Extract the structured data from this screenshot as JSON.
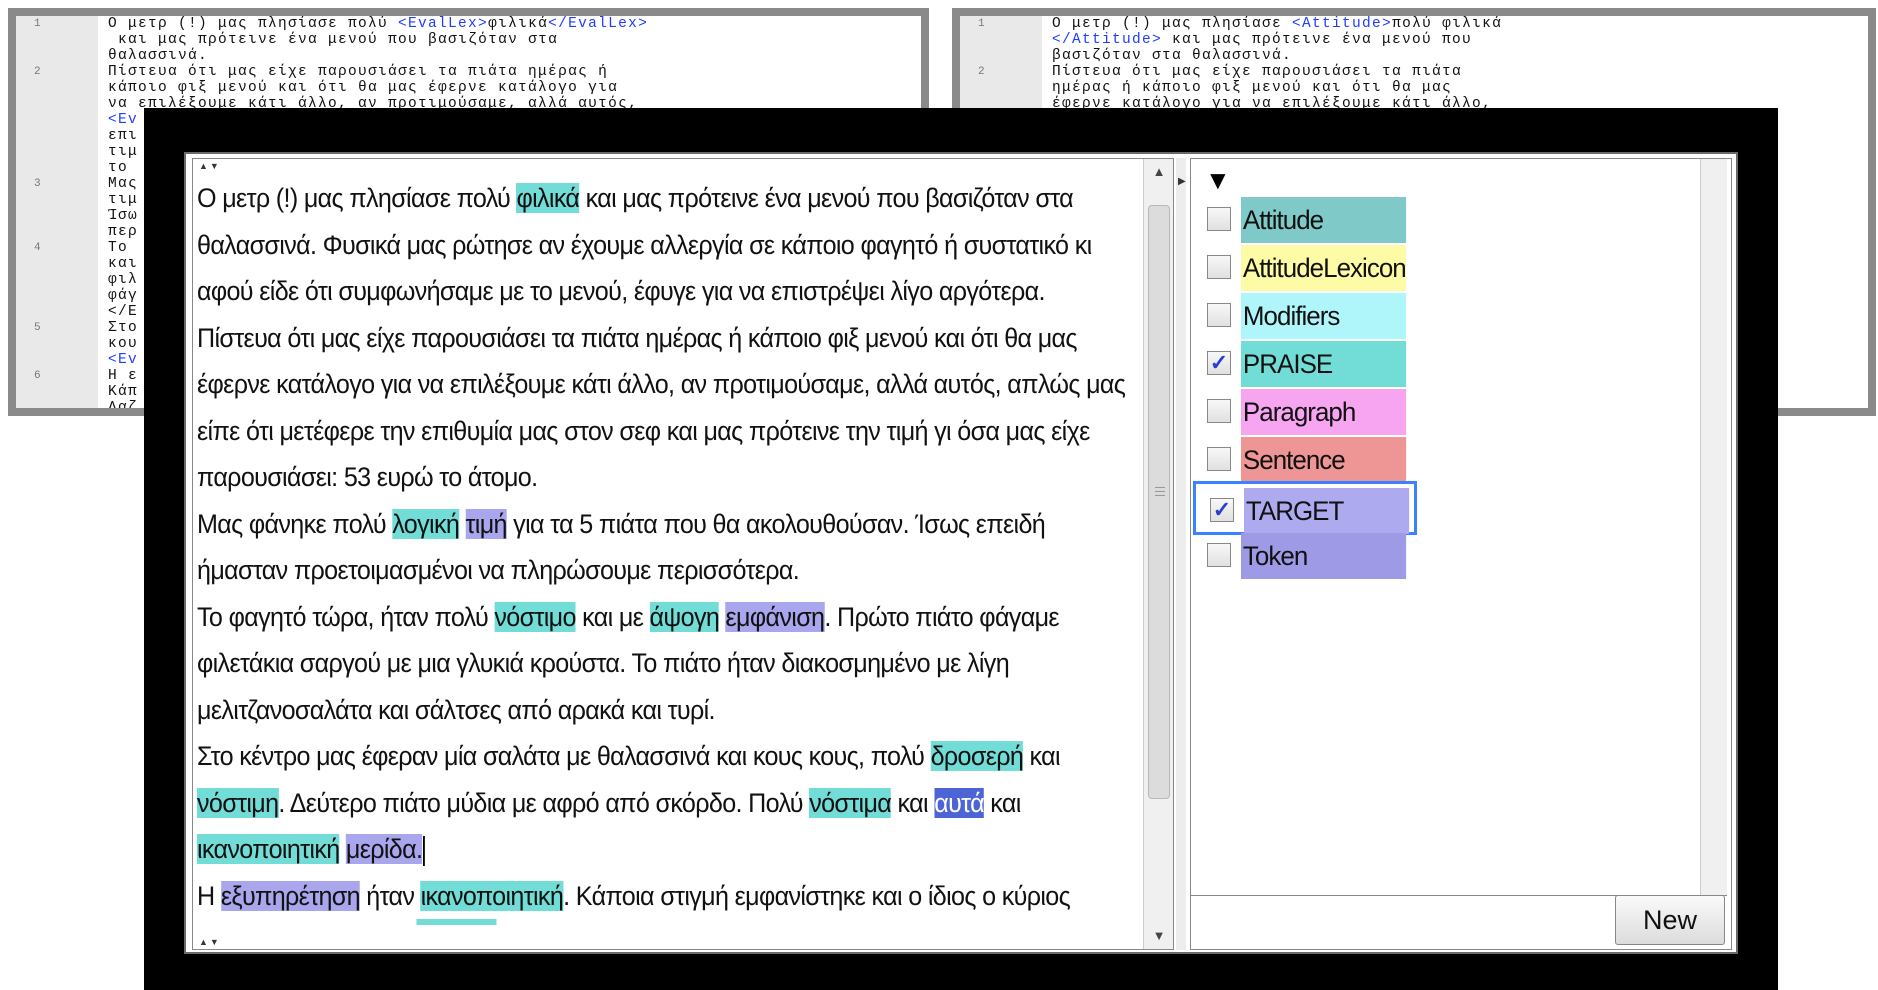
{
  "xml_left": {
    "lines": [
      {
        "num": "1",
        "text": "Ο μετρ (!) μας πλησίασε πολύ <EvalLex>φιλικά</EvalLex>\n και μας πρότεινε ένα μενού που βασιζόταν στα\nθαλασσινά."
      },
      {
        "num": "2",
        "text": "Πίστευα ότι μας είχε παρουσιάσει τα πιάτα ημέρας ή\nκάποιο φιξ μενού και ότι θα μας έφερνε κατάλογο για\nνα επιλέξουμε κάτι άλλο, αν προτιμούσαμε, αλλά αυτός,\n<Ev\nεπι\nτιμ\nτο"
      },
      {
        "num": "3",
        "text": "Μας\nτιμ\nΊσω\nπερ"
      },
      {
        "num": "4",
        "text": "Το\nκαι\nφιλ\nφάγ\n</E"
      },
      {
        "num": "5",
        "text": "Στο\nκου\n<Ev"
      },
      {
        "num": "6",
        "text": "Η ε\nΚάπ\nΛαζ\nπολ"
      }
    ]
  },
  "xml_right": {
    "lines": [
      {
        "num": "1",
        "text": "Ο μετρ (!) μας πλησίασε <Attitude>πολύ φιλικά\n</Attitude> και μας πρότεινε ένα μενού που\nβασιζόταν στα θαλασσινά."
      },
      {
        "num": "2",
        "text": "Πίστευα ότι μας είχε παρουσιάσει τα πιάτα\nημέρας ή κάποιο φιξ μενού και ότι θα μας\nέφερνε κατάλογο για να επιλέξουμε κάτι άλλο,\nότι μετέφερε την επιθυμία μας στον σεφ και μας"
      }
    ]
  },
  "editor": {
    "paragraphs": [
      [
        {
          "t": "Ο μετρ (!) μας πλησίασε πολύ "
        },
        {
          "t": "φιλικά",
          "h": "praise"
        },
        {
          "t": " και μας πρότεινε ένα μενού που βασιζόταν στα θαλασσινά. Φυσικά μας ρώτησε αν έχουμε αλλεργία σε κάποιο φαγητό ή συστατικό κι αφού είδε ότι συμφωνήσαμε με το μενού, έφυγε για να επιστρέψει λίγο αργότερα."
        }
      ],
      [
        {
          "t": "Πίστευα ότι μας είχε παρουσιάσει τα πιάτα ημέρας ή κάποιο φιξ μενού και ότι θα μας έφερνε κατάλογο για να επιλέξουμε κάτι άλλο, αν προτιμούσαμε, αλλά αυτός, απλώς μας είπε ότι μετέφερε την επιθυμία μας στον σεφ και μας πρότεινε την τιμή γι όσα μας είχε παρουσιάσει: 53 ευρώ το άτομο."
        }
      ],
      [
        {
          "t": "Μας φάνηκε πολύ "
        },
        {
          "t": "λογική",
          "h": "praise"
        },
        {
          "t": " "
        },
        {
          "t": "τιμή",
          "h": "target"
        },
        {
          "t": " για τα 5 πιάτα που θα ακολουθούσαν. Ίσως επειδή ήμασταν προετοιμασμένοι να πληρώσουμε περισσότερα."
        }
      ],
      [
        {
          "t": "Το φαγητό τώρα, ήταν πολύ "
        },
        {
          "t": "νόστιμο",
          "h": "praise"
        },
        {
          "t": " και με "
        },
        {
          "t": "άψογη",
          "h": "praise"
        },
        {
          "t": " "
        },
        {
          "t": "εμφάνιση",
          "h": "target"
        },
        {
          "t": ". Πρώτο πιάτο φάγαμε φιλετάκια σαργού με μια γλυκιά κρούστα. Το πιάτο ήταν διακοσμημένο με λίγη μελιτζανοσαλάτα και σάλτσες από αρακά και τυρί."
        }
      ],
      [
        {
          "t": "Στο κέντρο μας έφεραν μία σαλάτα με θαλασσινά και κους κους, πολύ "
        },
        {
          "t": "δροσερή",
          "h": "praise"
        },
        {
          "t": " και "
        },
        {
          "t": "νόστιμη",
          "h": "praise"
        },
        {
          "t": ". Δεύτερο πιάτο μύδια με αφρό από σκόρδο. Πολύ "
        },
        {
          "t": "νόστιμα",
          "h": "praise"
        },
        {
          "t": " και "
        },
        {
          "t": "αυτά",
          "h": "sel"
        },
        {
          "t": " και "
        },
        {
          "t": "ικανοποιητική",
          "h": "praise"
        },
        {
          "t": " "
        },
        {
          "t": "μερίδα.",
          "h": "target"
        },
        {
          "t": "",
          "caret": true
        }
      ],
      [
        {
          "t": "Η "
        },
        {
          "t": "εξυπηρέτηση",
          "h": "target"
        },
        {
          "t": " ήταν "
        },
        {
          "t": "ικανοποιητική",
          "h": "praise"
        },
        {
          "t": ". Κάποια στιγμή εμφανίστηκε και ο ίδιος ο κύριος"
        }
      ]
    ]
  },
  "tags": [
    {
      "label": "Attitude",
      "color": "#7fcac8",
      "checked": false
    },
    {
      "label": "AttitudeLexicon",
      "color": "#fdfba6",
      "checked": false
    },
    {
      "label": "Modifiers",
      "color": "#aff6fa",
      "checked": false
    },
    {
      "label": "PRAISE",
      "color": "#72dcd6",
      "checked": true
    },
    {
      "label": "Paragraph",
      "color": "#f7a5f0",
      "checked": false
    },
    {
      "label": "Sentence",
      "color": "#ee9595",
      "checked": false
    },
    {
      "label": "TARGET",
      "color": "#adaaf0",
      "checked": true,
      "focused": true
    },
    {
      "label": "Token",
      "color": "#9e9ae6",
      "checked": false
    }
  ],
  "buttons": {
    "new_label": "New"
  },
  "icons": {
    "dropdown": "▼",
    "scroll_up": "▲",
    "scroll_down": "▼",
    "splitter_arrow": "▶",
    "checkmark": "✓"
  }
}
